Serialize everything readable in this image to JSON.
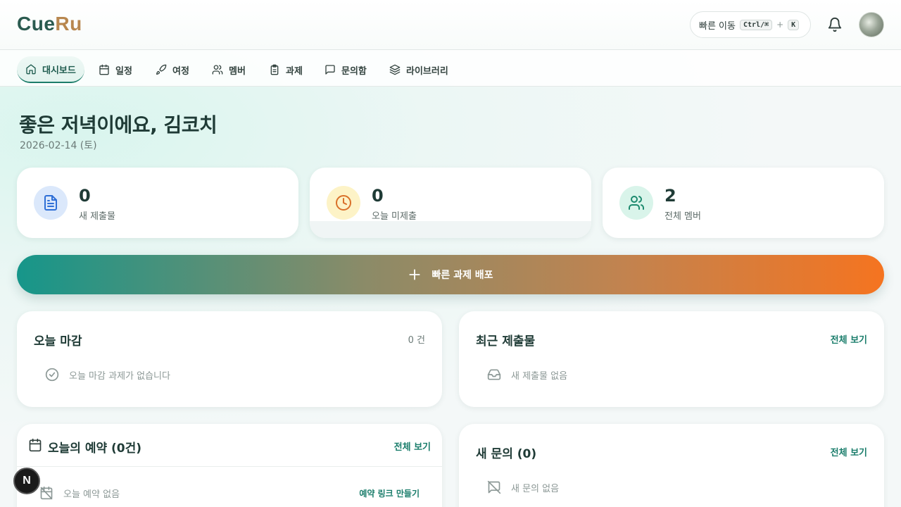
{
  "app": {
    "logo_part1": "Cue",
    "logo_part2": "Ru"
  },
  "header": {
    "quick_nav_label": "빠른 이동",
    "shortcut_key1": "Ctrl/⌘",
    "shortcut_plus": "+",
    "shortcut_key2": "K"
  },
  "nav": {
    "tabs": [
      {
        "label": "대시보드",
        "icon": "home-icon",
        "active": true
      },
      {
        "label": "일정",
        "icon": "calendar-icon"
      },
      {
        "label": "여정",
        "icon": "rocket-icon"
      },
      {
        "label": "멤버",
        "icon": "users-icon"
      },
      {
        "label": "과제",
        "icon": "clipboard-icon"
      },
      {
        "label": "문의함",
        "icon": "message-icon"
      },
      {
        "label": "라이브러리",
        "icon": "layers-icon"
      }
    ]
  },
  "greeting": {
    "text": "좋은 저녁이에요, 김코치",
    "date": "2026-02-14 (토)"
  },
  "stats": [
    {
      "value": "0",
      "label": "새 제출물",
      "icon": "document-icon",
      "color": "#2f6fd6",
      "bg": "#dbe8fb"
    },
    {
      "value": "0",
      "label": "오늘 미제출",
      "icon": "clock-icon",
      "color": "#d9702a",
      "bg": "#fdf3c7"
    },
    {
      "value": "2",
      "label": "전체 멤버",
      "icon": "users-icon",
      "color": "#1c8a6e",
      "bg": "#d9f4ea"
    }
  ],
  "cta": {
    "label": "빠른 과제 배포"
  },
  "panels": {
    "today_deadline": {
      "title": "오늘 마감",
      "count": "0 건",
      "empty": "오늘 마감 과제가 없습니다"
    },
    "recent_submissions": {
      "title": "최근 제출물",
      "link": "전체 보기",
      "empty": "새 제출물 없음"
    },
    "today_bookings": {
      "title": "오늘의 예약 (0건)",
      "link": "전체 보기",
      "empty": "오늘 예약 없음",
      "action": "예약 링크 만들기"
    },
    "new_inquiries": {
      "title": "새 문의 (0)",
      "link": "전체 보기",
      "empty": "새 문의 없음"
    }
  },
  "dev_badge": "N",
  "colors": {
    "accent": "#1a7d6b",
    "cta_start": "#16968a",
    "cta_end": "#f57420"
  }
}
